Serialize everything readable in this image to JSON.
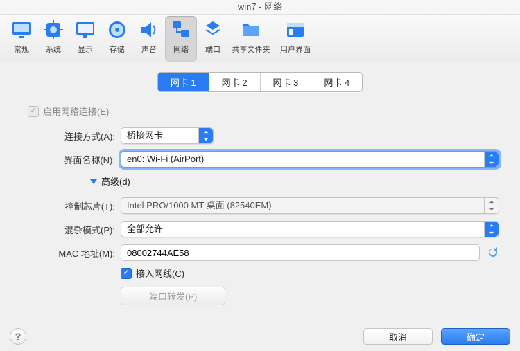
{
  "title": "win7 - 网络",
  "toolbar": [
    {
      "id": "general",
      "label": "常规"
    },
    {
      "id": "system",
      "label": "系统"
    },
    {
      "id": "display",
      "label": "显示"
    },
    {
      "id": "storage",
      "label": "存储"
    },
    {
      "id": "audio",
      "label": "声音"
    },
    {
      "id": "network",
      "label": "网络",
      "selected": true
    },
    {
      "id": "ports",
      "label": "端口"
    },
    {
      "id": "shared",
      "label": "共享文件夹"
    },
    {
      "id": "ui",
      "label": "用户界面"
    }
  ],
  "tabs": [
    {
      "label": "网卡 1",
      "active": true
    },
    {
      "label": "网卡 2"
    },
    {
      "label": "网卡 3"
    },
    {
      "label": "网卡 4"
    }
  ],
  "form": {
    "enable": {
      "label": "启用网络连接(E)",
      "checked": true,
      "disabled": true
    },
    "attach": {
      "label": "连接方式(A):",
      "value": "桥接网卡"
    },
    "iface": {
      "label": "界面名称(N):",
      "value": "en0: Wi-Fi (AirPort)",
      "focused": true
    },
    "advanced": {
      "label": "高级(d)"
    },
    "chip": {
      "label": "控制芯片(T):",
      "value": "Intel PRO/1000 MT 桌面 (82540EM)",
      "disabled": true
    },
    "promisc": {
      "label": "混杂模式(P):",
      "value": "全部允许"
    },
    "mac": {
      "label": "MAC 地址(M):",
      "value": "08002744AE58"
    },
    "cable": {
      "label": "接入网线(C)",
      "checked": true
    },
    "portfwd": {
      "label": "端口转发(P)"
    }
  },
  "footer": {
    "cancel": "取消",
    "ok": "确定"
  }
}
